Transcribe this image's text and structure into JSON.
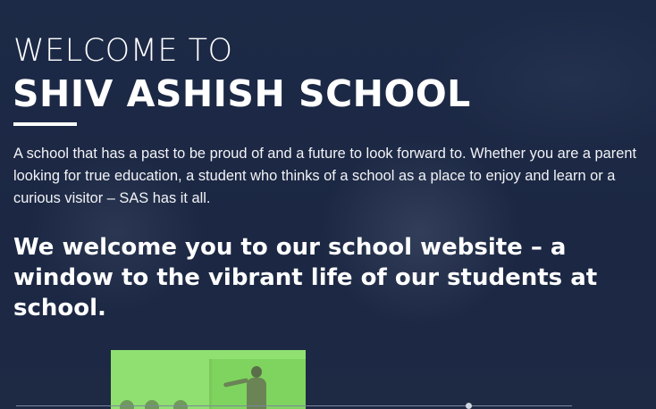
{
  "hero": {
    "welcome_line": "WELCOME TO",
    "school_name": "SHIV ASHISH SCHOOL",
    "intro_text": "A school that has a past to be proud of and a future to look forward to. Whether you are a parent looking for true education, a student who thinks of a school as a place to enjoy and learn or a curious visitor – SAS has it all.",
    "tagline": "We welcome you to our school website – a window to the vibrant life of our students at school."
  },
  "colors": {
    "background": "#1b2743",
    "text": "#ffffff",
    "thumbnail_green": "#8fe070"
  }
}
